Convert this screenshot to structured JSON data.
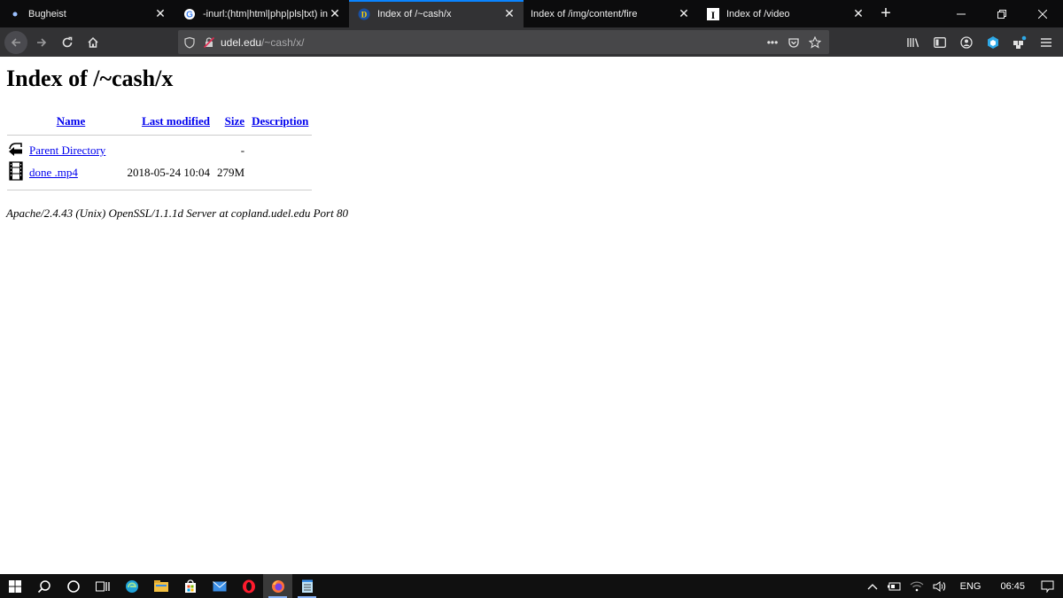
{
  "browser": {
    "tabs": [
      {
        "label": "Bugheist",
        "favicon": "dot-icon",
        "active": false
      },
      {
        "label": "-inurl:(htm|html|php|pls|txt) in",
        "favicon": "google-icon",
        "active": false
      },
      {
        "label": "Index of /~cash/x",
        "favicon": "udel-icon",
        "active": true
      },
      {
        "label": "Index of /img/content/fire",
        "favicon": "",
        "active": false
      },
      {
        "label": "Index of /video",
        "favicon": "i-icon",
        "active": false
      }
    ],
    "url": {
      "host": "udel.edu",
      "path": "/~cash/x/"
    },
    "more_label": "•••"
  },
  "page": {
    "title": "Index of /~cash/x",
    "columns": {
      "name": "Name",
      "modified": "Last modified",
      "size": "Size",
      "description": "Description"
    },
    "rows": [
      {
        "name": "Parent Directory",
        "modified": "",
        "size": "-",
        "icon": "back-folder-icon"
      },
      {
        "name": "done .mp4",
        "modified": "2018-05-24 10:04",
        "size": "279M",
        "icon": "film-icon"
      }
    ],
    "footer": "Apache/2.4.43 (Unix) OpenSSL/1.1.1d Server at copland.udel.edu Port 80"
  },
  "taskbar": {
    "language": "ENG",
    "time": "06:45"
  },
  "colors": {
    "tab_active_accent": "#0a84ff",
    "link": "#0000ee",
    "tabstrip_bg": "#0c0c0d",
    "toolbar_bg": "#323234"
  }
}
